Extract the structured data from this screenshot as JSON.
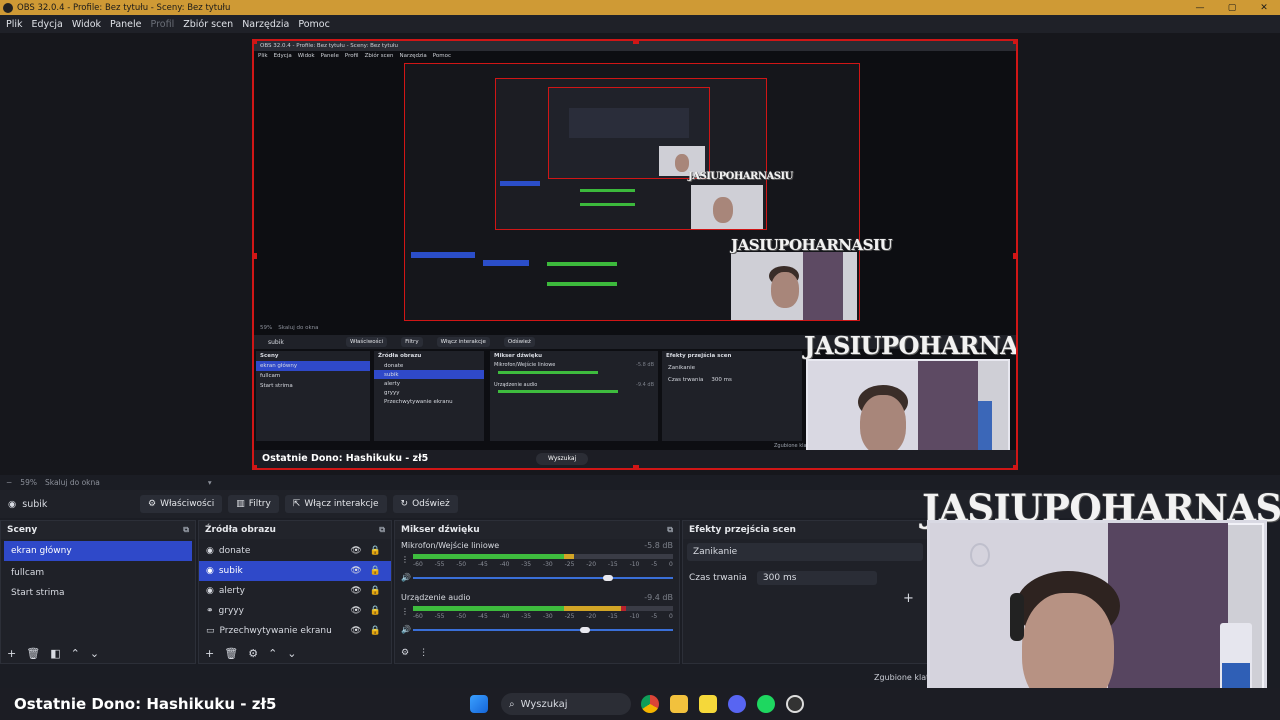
{
  "window": {
    "title": "OBS 32.0.4 - Profile: Bez tytułu - Sceny: Bez tytułu",
    "minimize": "—",
    "maximize": "▢",
    "close": "✕"
  },
  "menu": {
    "items": [
      "Plik",
      "Edycja",
      "Widok",
      "Panele",
      "Profil",
      "Zbiór scen",
      "Narzędzia",
      "Pomoc"
    ]
  },
  "nested_preview": {
    "title": "OBS 32.0.4 - Profile: Bez tytułu - Sceny: Bez tytułu",
    "menu": [
      "Plik",
      "Edycja",
      "Widok",
      "Panele",
      "Profil",
      "Zbiór scen",
      "Narzędzia",
      "Pomoc"
    ],
    "zoom": "59%",
    "scale_label": "Skaluj do okna",
    "source": "subik",
    "buttons": [
      "Właściwości",
      "Filtry",
      "Włącz interakcje",
      "Odśwież"
    ],
    "scenes_title": "Sceny",
    "scenes": [
      "ekran główny",
      "fullcam",
      "Start strima"
    ],
    "sources_title": "Źródła obrazu",
    "sources": [
      "donate",
      "subik",
      "alerty",
      "gryyy",
      "Przechwytywanie ekranu"
    ],
    "mixer_title": "Mikser dźwięku",
    "mixer_ch1": "Mikrofon/Wejście liniowe",
    "mixer_ch1_db": "-5.8 dB",
    "mixer_ch2": "Urządzenie audio",
    "mixer_ch2_db": "-9.4 dB",
    "transitions_title": "Efekty przejścia scen",
    "transition": "Zanikanie",
    "duration_label": "Czas trwania",
    "duration": "300 ms",
    "ticker": "Ostatnie Dono: Hashikuku - zł5",
    "search": "Wyszukaj",
    "status": "Zgubione klatki"
  },
  "watermark": "JASIUPOHARNASIU",
  "zoom_row": {
    "minus": "−",
    "zoom": "59%",
    "scale": "Skaluj do okna"
  },
  "source_bar": {
    "name": "subik",
    "properties": "Właściwości",
    "filters": "Filtry",
    "interact": "Włącz interakcje",
    "refresh": "Odśwież"
  },
  "scenes": {
    "title": "Sceny",
    "items": [
      {
        "label": "ekran główny",
        "selected": true
      },
      {
        "label": "fullcam",
        "selected": false
      },
      {
        "label": "Start strima",
        "selected": false
      }
    ]
  },
  "sources": {
    "title": "Źródła obrazu",
    "items": [
      {
        "label": "donate",
        "icon": "browser-source-icon",
        "selected": false
      },
      {
        "label": "subik",
        "icon": "browser-source-icon",
        "selected": true
      },
      {
        "label": "alerty",
        "icon": "browser-source-icon",
        "selected": false
      },
      {
        "label": "gryyy",
        "icon": "link-icon",
        "selected": false
      },
      {
        "label": "Przechwytywanie ekranu",
        "icon": "monitor-icon",
        "selected": false
      }
    ]
  },
  "mixer": {
    "title": "Mikser dźwięku",
    "ticks": [
      "-60",
      "-55",
      "-50",
      "-45",
      "-40",
      "-35",
      "-30",
      "-25",
      "-20",
      "-15",
      "-10",
      "-5",
      "0"
    ],
    "channels": [
      {
        "name": "Mikrofon/Wejście liniowe",
        "db": "-5.8 dB",
        "level": 0.62,
        "volume": 0.75
      },
      {
        "name": "Urządzenie audio",
        "db": "-9.4 dB",
        "level": 0.82,
        "volume": 0.66
      }
    ]
  },
  "transitions": {
    "title": "Efekty przejścia scen",
    "selected": "Zanikanie",
    "duration_label": "Czas trwania",
    "duration": "300 ms",
    "add": "+"
  },
  "status": {
    "dropped": "Zgubione klatki"
  },
  "taskbar": {
    "ticker": "Ostatnie Dono: Hashikuku - zł5",
    "search": "Wyszukaj"
  },
  "colors": {
    "accent": "#2f49c9",
    "titlebar": "#cf9a35",
    "selection_border": "#d01616",
    "meter_green": "#3ebc3e",
    "meter_yellow": "#d2a526",
    "meter_red": "#b8222c"
  }
}
